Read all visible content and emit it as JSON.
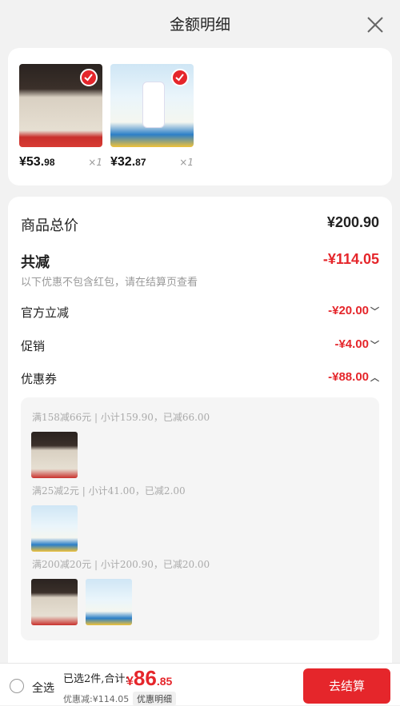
{
  "header": {
    "title": "金额明细"
  },
  "products": [
    {
      "price_int": "¥53.",
      "price_dec": "98",
      "qty": "×1"
    },
    {
      "price_int": "¥32.",
      "price_dec": "87",
      "qty": "×1"
    }
  ],
  "summary": {
    "total_label": "商品总价",
    "total_value": "¥200.90",
    "reduce_label": "共减",
    "reduce_value": "-¥114.05",
    "note": "以下优惠不包含红包，请在结算页查看",
    "items": [
      {
        "label": "官方立减",
        "value": "-¥20.00",
        "chev": "﹀"
      },
      {
        "label": "促销",
        "value": "-¥4.00",
        "chev": "﹀"
      },
      {
        "label": "优惠券",
        "value": "-¥88.00",
        "chev": "︿"
      }
    ]
  },
  "coupons": [
    {
      "text": "满158减66元 | 小计159.90，已减66.00"
    },
    {
      "text": "满25减2元 | 小计41.00，已减2.00"
    },
    {
      "text": "满200减20元 | 小计200.90，已减20.00"
    }
  ],
  "bottom": {
    "select_all": "全选",
    "selected": "已选2件,合计:",
    "currency": "¥",
    "total_int": "86",
    "total_dec": ".85",
    "discount": "优惠减:¥114.05",
    "detail": "优惠明细",
    "checkout": "去结算"
  },
  "colors": {
    "accent": "#e5262b"
  }
}
